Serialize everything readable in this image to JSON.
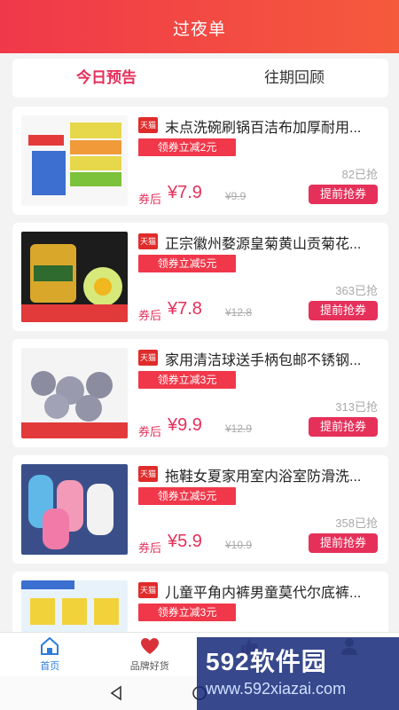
{
  "header": {
    "title": "过夜单"
  },
  "tabs": [
    {
      "label": "今日预告",
      "active": true
    },
    {
      "label": "往期回顾",
      "active": false
    }
  ],
  "products": [
    {
      "platform": "天猫",
      "title": "末点洗碗刷锅百洁布加厚耐用...",
      "coupon": "领券立减2元",
      "sold": "82已抢",
      "after_label": "券后",
      "price": "¥7.9",
      "original": "¥9.9",
      "button": "提前抢券"
    },
    {
      "platform": "天猫",
      "title": "正宗徽州婺源皇菊黄山贡菊花...",
      "coupon": "领券立减5元",
      "sold": "363已抢",
      "after_label": "券后",
      "price": "¥7.8",
      "original": "¥12.8",
      "button": "提前抢券"
    },
    {
      "platform": "天猫",
      "title": "家用清洁球送手柄包邮不锈钢...",
      "coupon": "领券立减3元",
      "sold": "313已抢",
      "after_label": "券后",
      "price": "¥9.9",
      "original": "¥12.9",
      "button": "提前抢券"
    },
    {
      "platform": "天猫",
      "title": "拖鞋女夏家用室内浴室防滑洗...",
      "coupon": "领券立减5元",
      "sold": "358已抢",
      "after_label": "券后",
      "price": "¥5.9",
      "original": "¥10.9",
      "button": "提前抢券"
    },
    {
      "platform": "天猫",
      "title": "儿童平角内裤男童莫代尔底裤...",
      "coupon": "领券立减3元"
    }
  ],
  "bottom_nav": [
    {
      "label": "首页",
      "icon": "home-icon",
      "active": true
    },
    {
      "label": "品牌好货",
      "icon": "heart-icon",
      "active": false
    }
  ],
  "watermark": {
    "logo": "592软件园",
    "url": "www.592xiazai.com"
  },
  "colors": {
    "accent": "#e5305a",
    "header": "#f0384a",
    "nav_active": "#2d7ddf"
  }
}
